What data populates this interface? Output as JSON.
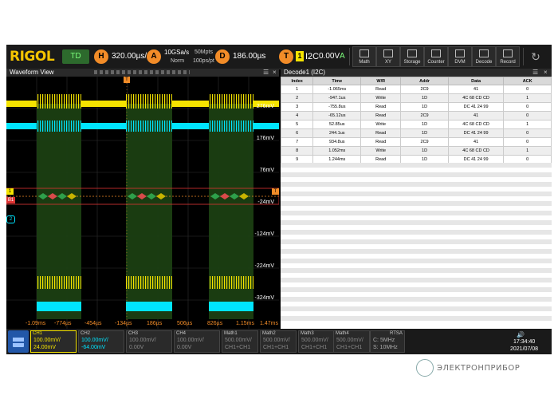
{
  "topbar": {
    "logo": "RIGOL",
    "mode": "TD",
    "horizontal_badge": "H",
    "timebase": "320.00µs/",
    "acq_badge": "A",
    "sample_rate": "10GSa/s",
    "acq_mode": "Norm",
    "memory_depth": "50Mpts",
    "points_per_div": "100ps/pt",
    "delay_badge": "D",
    "delay": "186.00µs",
    "trigger_badge": "T",
    "trigger_source": "1",
    "trigger_type": "I2C",
    "trigger_level": "0.00V",
    "trigger_mode": "A",
    "tools": [
      "Math",
      "XY",
      "Storage",
      "Counter",
      "DVM",
      "Decode",
      "Record"
    ]
  },
  "waveform": {
    "title": "Waveform View",
    "y_labels": [
      "276mV",
      "176mV",
      "76mV",
      "-24mV",
      "-124mV",
      "-224mV",
      "-324mV"
    ],
    "x_labels": [
      "-1.09ms",
      "-774µs",
      "-454µs",
      "-134µs",
      "186µs",
      "506µs",
      "826µs",
      "1.15ms",
      "1.47ms"
    ],
    "ch1_marker": "1",
    "ch2_marker": "2",
    "bus_marker": "B1",
    "trigger_marker": "T"
  },
  "decode": {
    "title": "Decode1 (I2C)",
    "columns": [
      "Index",
      "Time",
      "W/R",
      "Addr",
      "Data",
      "ACK"
    ],
    "rows": [
      [
        "1",
        "-1.065ms",
        "Read",
        "2C9",
        "41",
        "0"
      ],
      [
        "2",
        "-947.1us",
        "Write",
        "1D",
        "4C 68 CD CD",
        "1"
      ],
      [
        "3",
        "-755.8us",
        "Read",
        "1D",
        "DC 41 24 99",
        "0"
      ],
      [
        "4",
        "-65.12us",
        "Read",
        "2C9",
        "41",
        "0"
      ],
      [
        "5",
        "52.85us",
        "Write",
        "1D",
        "4C 68 CD CD",
        "1"
      ],
      [
        "6",
        "244.1us",
        "Read",
        "1D",
        "DC 41 24 99",
        "0"
      ],
      [
        "7",
        "934.8us",
        "Read",
        "2C9",
        "41",
        "0"
      ],
      [
        "8",
        "1.052ms",
        "Write",
        "1D",
        "4C 68 CD CD",
        "1"
      ],
      [
        "9",
        "1.244ms",
        "Read",
        "1D",
        "DC 41 24 99",
        "0"
      ]
    ]
  },
  "bottom": {
    "channels": [
      {
        "name": "CH1",
        "scale": "100.00mV/",
        "offset": "24.00mV",
        "color": "#f5e400"
      },
      {
        "name": "CH2",
        "scale": "100.00mV/",
        "offset": "-64.00mV",
        "color": "#00e5ff"
      },
      {
        "name": "CH3",
        "scale": "100.00mV/",
        "offset": "0.00V",
        "color": "#888888"
      },
      {
        "name": "CH4",
        "scale": "100.00mV/",
        "offset": "0.00V",
        "color": "#888888"
      },
      {
        "name": "Math1",
        "scale": "500.00mV/",
        "offset": "CH1+CH1",
        "color": "#888888"
      },
      {
        "name": "Math2",
        "scale": "500.00mV/",
        "offset": "CH1+CH1",
        "color": "#888888"
      },
      {
        "name": "Math3",
        "scale": "500.00mV/",
        "offset": "CH1+CH1",
        "color": "#888888"
      },
      {
        "name": "Math4",
        "scale": "500.00mV/",
        "offset": "CH1+CH1",
        "color": "#888888"
      }
    ],
    "rtsa_label": "RTSA",
    "rtsa_center": "C: 5MHz",
    "rtsa_span": "S: 10MHz",
    "time": "17:34:40",
    "date": "2021/07/08"
  },
  "footer": {
    "brand": "ЭЛЕКТРОНПРИБОР"
  }
}
